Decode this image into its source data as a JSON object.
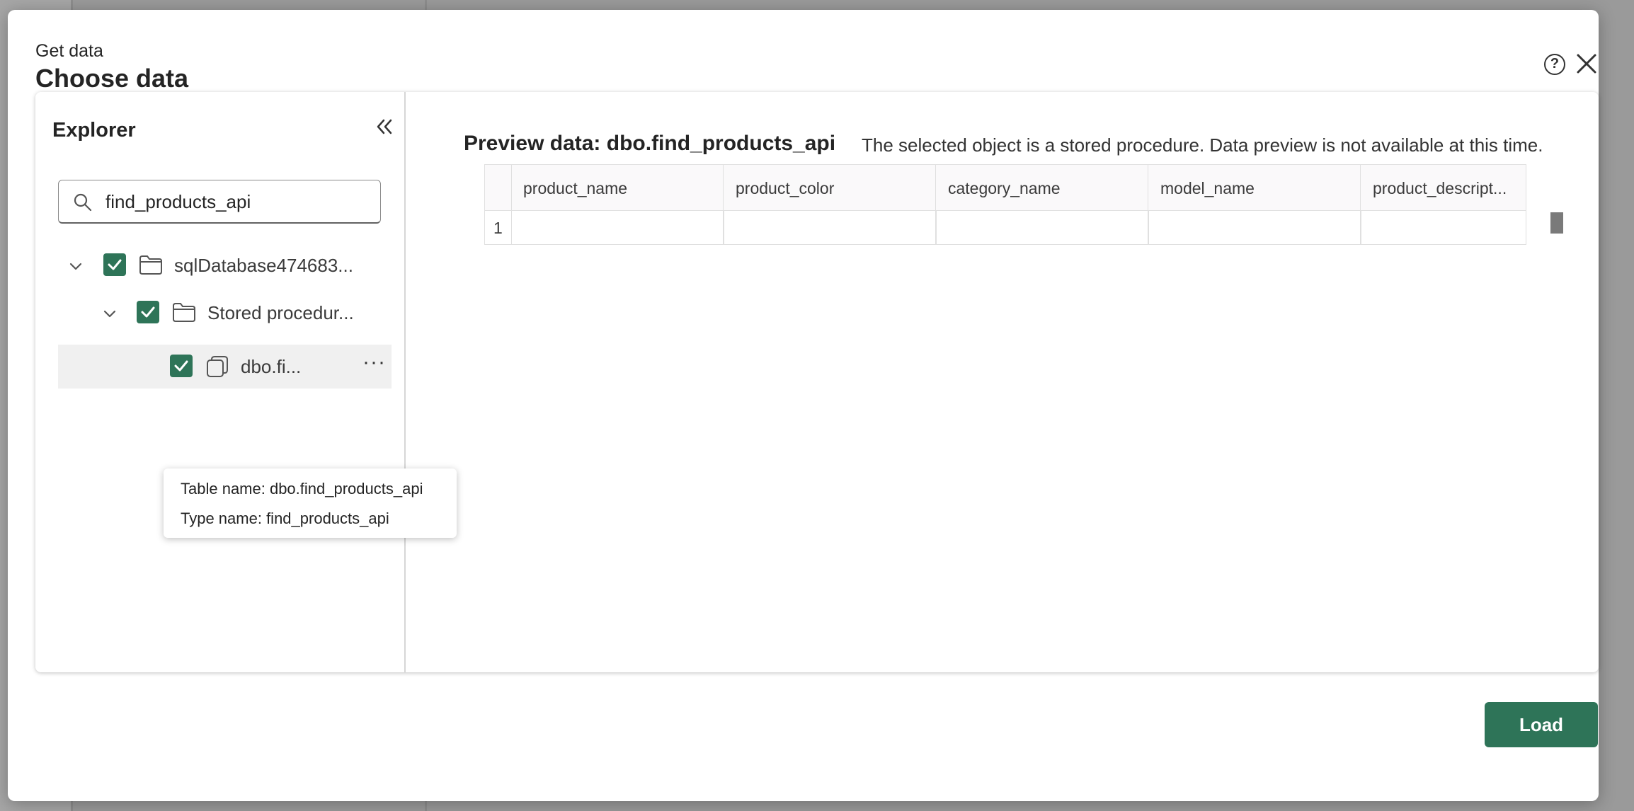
{
  "dialog": {
    "subtitle": "Get data",
    "title": "Choose data"
  },
  "explorer": {
    "title": "Explorer",
    "search": {
      "value": "find_products_api",
      "placeholder": ""
    },
    "tree": [
      {
        "label": "sqlDatabase474683...",
        "level": 0,
        "checked": true,
        "expanded": true,
        "icon": "folder-icon"
      },
      {
        "label": "Stored procedur...",
        "level": 1,
        "checked": true,
        "expanded": true,
        "icon": "folder-icon"
      },
      {
        "label": "dbo.fi...",
        "level": 2,
        "checked": true,
        "selected": true,
        "icon": "stored-procedure-icon",
        "more": "···"
      }
    ],
    "tooltip": {
      "table_name": "Table name: dbo.find_products_api",
      "type_name": "Type name: find_products_api"
    }
  },
  "preview": {
    "title": "Preview data: dbo.find_products_api",
    "message": "The selected object is a stored procedure. Data preview is not available at this time.",
    "columns": [
      "product_name",
      "product_color",
      "category_name",
      "model_name",
      "product_descript..."
    ],
    "rows": [
      {
        "num": "1",
        "cells": [
          "",
          "",
          "",
          "",
          ""
        ]
      }
    ]
  },
  "footer": {
    "load_label": "Load"
  },
  "colors": {
    "accent": "#2e7458",
    "grid_border": "#e0e0e0"
  }
}
